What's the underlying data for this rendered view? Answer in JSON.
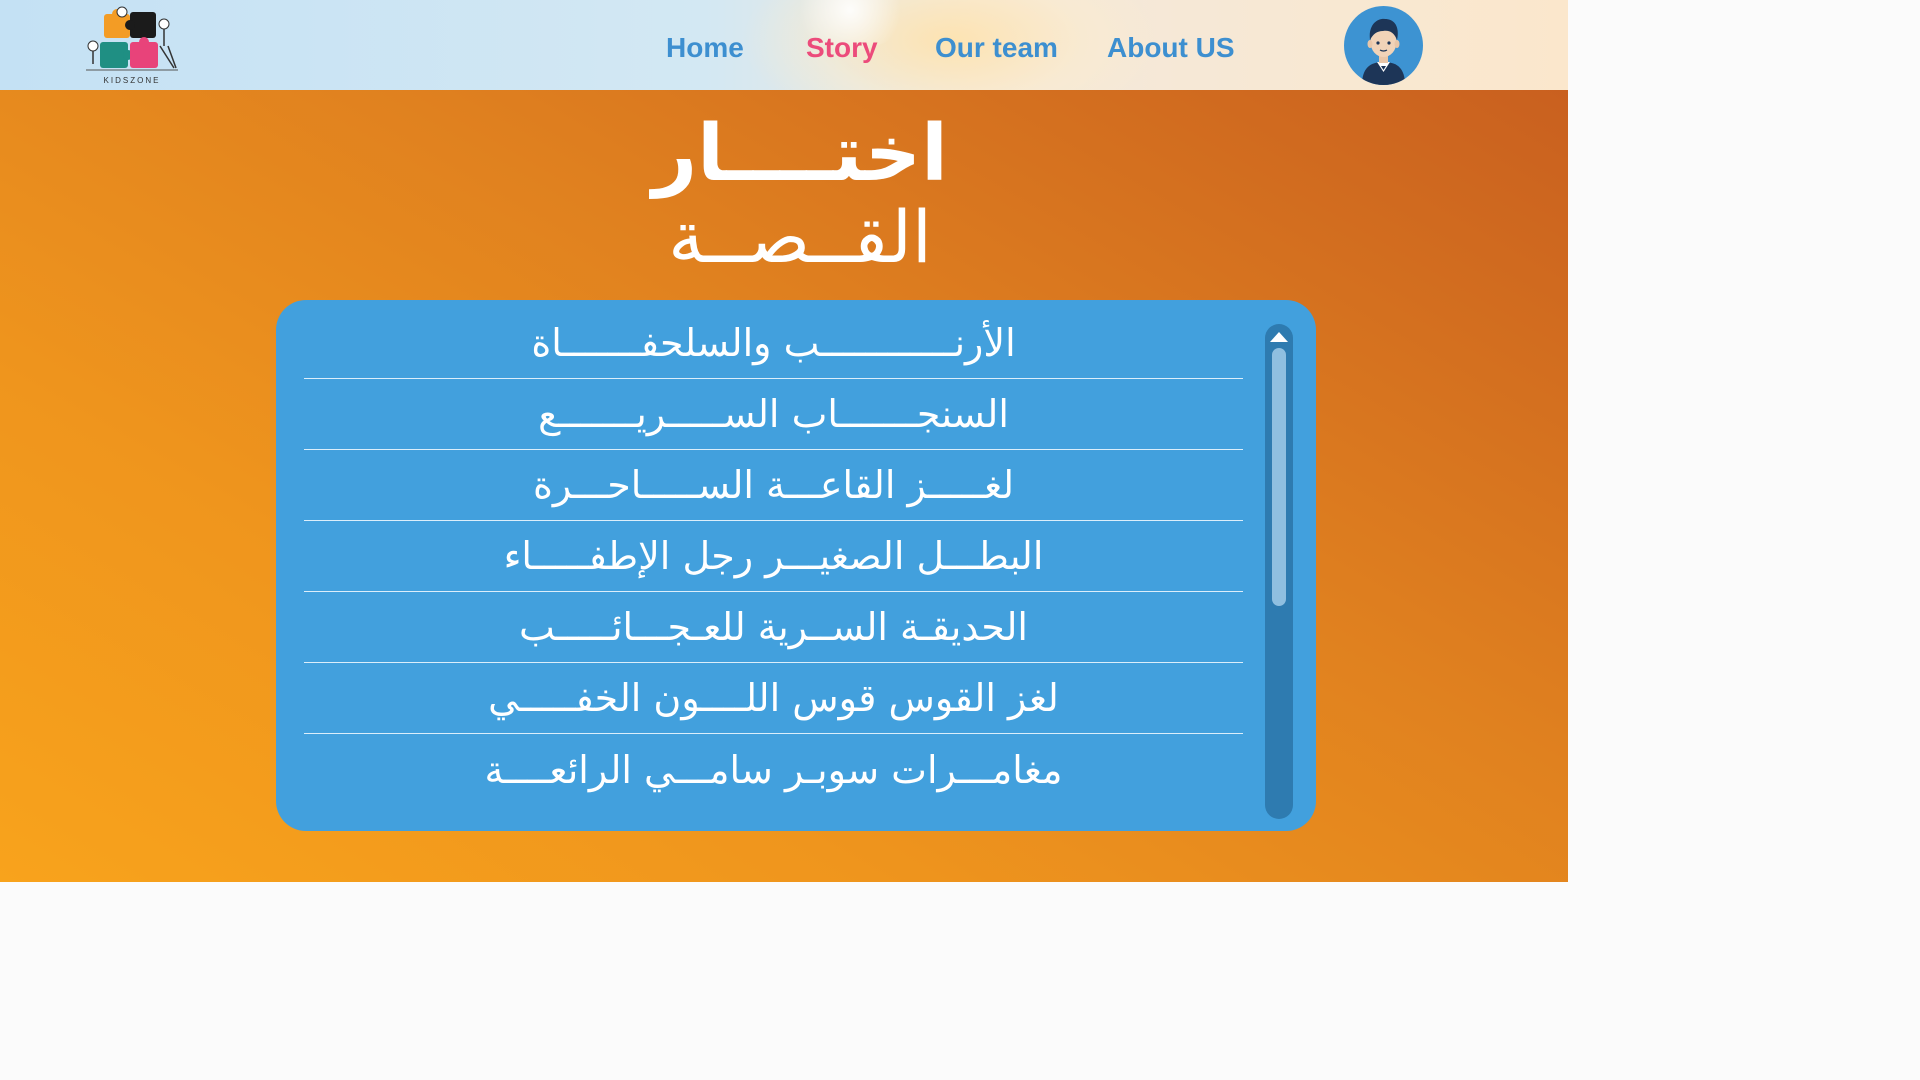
{
  "logo": {
    "text": "KIDSZONE",
    "icon": "puzzle-kids-logo"
  },
  "nav": {
    "items": [
      {
        "label": "Home",
        "active": false
      },
      {
        "label": "Story",
        "active": true
      },
      {
        "label": "Our team",
        "active": false
      },
      {
        "label": "About US",
        "active": false
      }
    ],
    "avatar_icon": "boy-avatar-icon"
  },
  "heading": {
    "line1": "اختــــار",
    "line2": "القــصــة"
  },
  "stories": [
    "الأرنــــــــــــب والسلحفـــــــاة",
    "السنجـــــــاب الســـــريـــــــع",
    "لغـــــز القاعـــة الســـــاحـــرة",
    "البطـــل الصغيـــر رجل الإطفـــــاء",
    "الحديقـة الســرية للعـجـــائـــــب",
    "لغز القوس قوس اللــــون الخفـــــي",
    "مغامـــرات سوبـر سامـــي الرائعــــة"
  ],
  "scrollbar": {
    "icon": "scroll-up-arrow-icon",
    "position": 0
  },
  "colors": {
    "nav_text": "#3d8fd0",
    "nav_active": "#ec4b7b",
    "panel": "#42a0dd",
    "background_orange": "#f8a31c"
  }
}
